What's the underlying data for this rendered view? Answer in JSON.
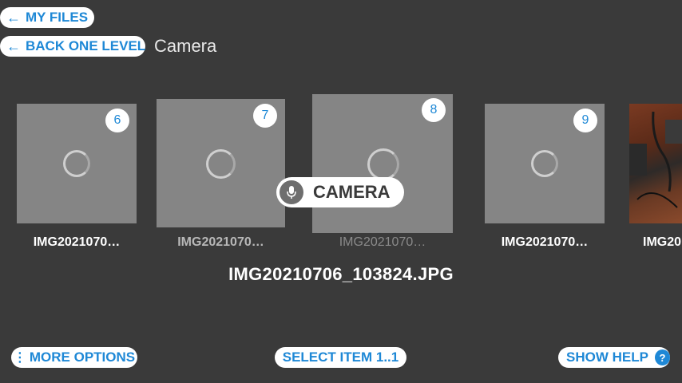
{
  "nav": {
    "my_files_label": "MY FILES",
    "back_label": "BACK ONE LEVEL",
    "folder_title": "Camera"
  },
  "items": [
    {
      "number": "6",
      "caption": "IMG2021070…"
    },
    {
      "number": "7",
      "caption": "IMG2021070…"
    },
    {
      "number": "8",
      "caption": "IMG2021070…"
    },
    {
      "number": "9",
      "caption": "IMG2021070…"
    },
    {
      "caption": "IMG20"
    }
  ],
  "voice_label": "CAMERA",
  "selected_name": "IMG20210706_103824.JPG",
  "bottom": {
    "more_options": "MORE OPTIONS",
    "select_item": "SELECT ITEM 1..1",
    "show_help": "SHOW HELP",
    "help_glyph": "?"
  },
  "colors": {
    "accent": "#1e88d6",
    "background": "#3a3a3a",
    "thumb": "#858585"
  }
}
